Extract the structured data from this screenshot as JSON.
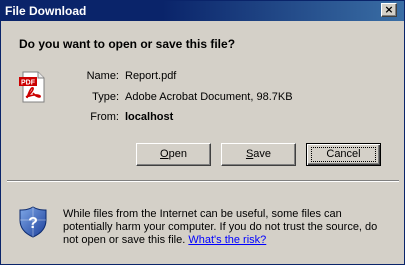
{
  "window": {
    "title": "File Download",
    "close_glyph": "×"
  },
  "dialog": {
    "question": "Do you want to open or save this file?"
  },
  "file": {
    "icon": "pdf-file-icon",
    "icon_text": "PDF",
    "rows": [
      {
        "label": "Name:",
        "value": "Report.pdf"
      },
      {
        "label": "Type:",
        "value": "Adobe Acrobat Document, 98.7KB"
      },
      {
        "label": "From:",
        "value": "localhost"
      }
    ]
  },
  "buttons": {
    "open": {
      "accel": "O",
      "rest": "pen"
    },
    "save": {
      "accel": "S",
      "rest": "ave"
    },
    "cancel": {
      "label": "Cancel"
    }
  },
  "info": {
    "icon": "security-shield-icon",
    "text": "While files from the Internet can be useful, some files can potentially harm your computer. If you do not trust the source, do not open or save this file.",
    "link": "What's the risk?"
  },
  "colors": {
    "titlebar": "#0a246a",
    "dialog_bg": "#d4d0c8",
    "link": "#0000ff"
  }
}
